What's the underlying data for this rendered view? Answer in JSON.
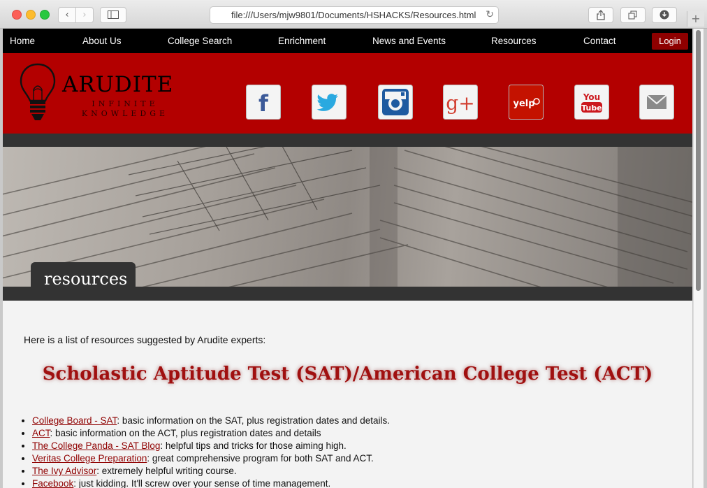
{
  "browser": {
    "url": "file:///Users/mjw9801/Documents/HSHACKS/Resources.html",
    "newtab_label": "+"
  },
  "nav": {
    "items": [
      {
        "label": "Home"
      },
      {
        "label": "About Us"
      },
      {
        "label": "College Search"
      },
      {
        "label": "Enrichment"
      },
      {
        "label": "News and Events"
      },
      {
        "label": "Resources"
      },
      {
        "label": "Contact"
      }
    ],
    "login_label": "Login"
  },
  "brand": {
    "name": "ARUDITE",
    "tagline": "INFINITE KNOWLEDGE"
  },
  "social": {
    "facebook_glyph": "f",
    "google_glyph": "g+",
    "yelp_text": "yelp",
    "youtube_top": "You",
    "youtube_bottom": "Tube"
  },
  "hero": {
    "page_title": "resources"
  },
  "content": {
    "intro": "Here is a list of resources suggested by Arudite experts:",
    "section_heading": "Scholastic Aptitude Test (SAT)/American College Test (ACT)",
    "resources": [
      {
        "link": "College Board - SAT",
        "desc": ": basic information on the SAT, plus registration dates and details."
      },
      {
        "link": "ACT",
        "desc": ": basic information on the ACT, plus registration dates and details"
      },
      {
        "link": "The College Panda - SAT Blog",
        "desc": ": helpful tips and tricks for those aiming high."
      },
      {
        "link": "Veritas College Preparation",
        "desc": ": great comprehensive program for both SAT and ACT."
      },
      {
        "link": "The Ivy Advisor",
        "desc": ": extremely helpful writing course."
      },
      {
        "link": "Facebook",
        "desc": ": just kidding. It'll screw over your sense of time management."
      }
    ]
  },
  "colors": {
    "brand_red": "#b30000",
    "nav_black": "#000000",
    "link_red": "#8f0000",
    "heading_red": "#a01010"
  }
}
